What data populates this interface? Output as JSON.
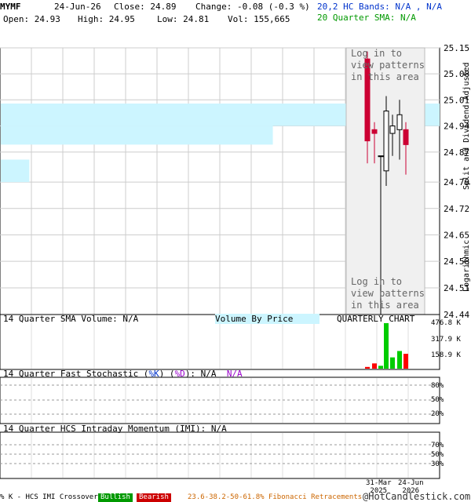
{
  "header": {
    "symbol": "MYMF",
    "date": "24-Jun-26",
    "close_label": "Close: 24.89",
    "change_label": "Change: -0.08 (-0.3 %)",
    "open_label": "Open: 24.93",
    "high_label": "High: 24.95",
    "low_label": "Low: 24.81",
    "vol_label": "Vol: 155,665",
    "hc_bands": "20,2 HC Bands: N/A , N/A",
    "sma": "20 Quarter SMA: N/A"
  },
  "price_panel": {
    "right_label_top": "Split and Dividend Adjusted",
    "right_label_bottom": "Logarithmic",
    "login_overlay": [
      "Log in to",
      "view patterns",
      "in this area"
    ]
  },
  "volume_panel": {
    "title": "14 Quarter SMA Volume: N/A",
    "vbp_label": "Volume By Price",
    "chart_label": "QUARTERLY CHART",
    "tick_labels": [
      "476.8 K",
      "317.9 K",
      "158.9 K"
    ]
  },
  "stoch_panel": {
    "title_prefix": "14 Quarter Fast Stochastic (",
    "title_k": "%K",
    "title_sep": ") (",
    "title_d": "%D",
    "title_suffix": "): N/A",
    "title_na2": "N/A",
    "tick_labels": [
      "80%",
      "50%",
      "20%"
    ]
  },
  "imi_panel": {
    "title": "14 Quarter HCS Intraday Momentum (IMI): N/A",
    "tick_labels": [
      "70%",
      "50%",
      "30%"
    ]
  },
  "footer": {
    "crossover": "% K - HCS IMI Crossover,",
    "bullish": "Bullish",
    "bearish": "Bearish",
    "fib": "23.6-38.2-50-61.8% Fibonacci Retracements",
    "copyright": "@HotCandlestick.com",
    "date_labels": [
      {
        "line1": "31-Mar",
        "line2": "2025"
      },
      {
        "line1": "24-Jun",
        "line2": "2026"
      }
    ]
  },
  "colors": {
    "up": "#000000",
    "down": "#cc0033",
    "vol_up": "#00cc00",
    "vol_down": "#ff0000",
    "vbp": "#ccf5ff",
    "bullish": "#009900",
    "bearish": "#cc0000",
    "fib": "#cc6600"
  },
  "chart_data": {
    "type": "candlestick",
    "symbol": "MYMF",
    "y_scale": "log",
    "ylim": [
      24.44,
      25.15
    ],
    "y_ticks": [
      25.15,
      25.08,
      25.01,
      24.94,
      24.87,
      24.79,
      24.72,
      24.65,
      24.58,
      24.51,
      24.44
    ],
    "candles": [
      {
        "open": 25.12,
        "high": 25.14,
        "low": 24.84,
        "close": 24.9,
        "volume": 18000
      },
      {
        "open": 24.93,
        "high": 24.95,
        "low": 24.84,
        "close": 24.92,
        "volume": 55000
      },
      {
        "open": 24.86,
        "high": 24.86,
        "low": 24.44,
        "close": 24.86,
        "volume": 30000
      },
      {
        "open": 24.82,
        "high": 25.02,
        "low": 24.78,
        "close": 24.98,
        "volume": 476800
      },
      {
        "open": 24.92,
        "high": 24.97,
        "low": 24.86,
        "close": 24.94,
        "volume": 118000
      },
      {
        "open": 24.93,
        "high": 25.01,
        "low": 24.85,
        "close": 24.97,
        "volume": 185000
      },
      {
        "open": 24.93,
        "high": 24.95,
        "low": 24.81,
        "close": 24.89,
        "volume": 155665
      }
    ],
    "volume_by_price": [
      {
        "low": 24.94,
        "high": 25.0,
        "rel": 1.0
      },
      {
        "low": 24.89,
        "high": 24.94,
        "rel": 0.62
      },
      {
        "low": 24.79,
        "high": 24.85,
        "rel": 0.065
      }
    ]
  }
}
